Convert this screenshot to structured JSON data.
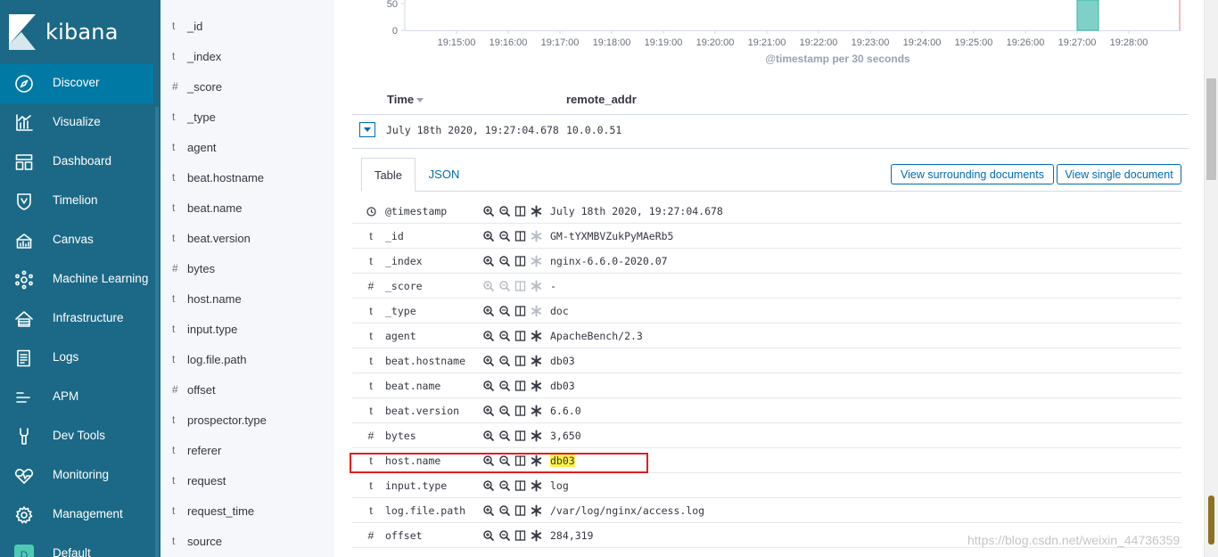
{
  "colors": {
    "nav_bg": "#1b6986",
    "nav_active": "#0079a5",
    "accent": "#006bb4",
    "bar": "#7fd1c8",
    "highlight": "#fff049",
    "annotation_box": "#e01e1e"
  },
  "nav": {
    "brand": "kibana",
    "items": [
      {
        "label": "Discover",
        "icon": "compass-icon",
        "active": true
      },
      {
        "label": "Visualize",
        "icon": "bar-chart-icon"
      },
      {
        "label": "Dashboard",
        "icon": "dashboard-icon"
      },
      {
        "label": "Timelion",
        "icon": "shield-icon"
      },
      {
        "label": "Canvas",
        "icon": "canvas-icon"
      },
      {
        "label": "Machine Learning",
        "icon": "ml-icon"
      },
      {
        "label": "Infrastructure",
        "icon": "infrastructure-icon"
      },
      {
        "label": "Logs",
        "icon": "logs-icon"
      },
      {
        "label": "APM",
        "icon": "apm-icon"
      },
      {
        "label": "Dev Tools",
        "icon": "wrench-icon"
      },
      {
        "label": "Monitoring",
        "icon": "heartbeat-icon"
      },
      {
        "label": "Management",
        "icon": "gear-icon"
      },
      {
        "label": "Default",
        "icon": "space-avatar-icon",
        "avatar_letter": "D"
      }
    ]
  },
  "field_list": [
    {
      "type": "t",
      "name": "_id"
    },
    {
      "type": "t",
      "name": "_index"
    },
    {
      "type": "#",
      "name": "_score"
    },
    {
      "type": "t",
      "name": "_type"
    },
    {
      "type": "t",
      "name": "agent"
    },
    {
      "type": "t",
      "name": "beat.hostname"
    },
    {
      "type": "t",
      "name": "beat.name"
    },
    {
      "type": "t",
      "name": "beat.version"
    },
    {
      "type": "#",
      "name": "bytes"
    },
    {
      "type": "t",
      "name": "host.name"
    },
    {
      "type": "t",
      "name": "input.type"
    },
    {
      "type": "t",
      "name": "log.file.path"
    },
    {
      "type": "#",
      "name": "offset"
    },
    {
      "type": "t",
      "name": "prospector.type"
    },
    {
      "type": "t",
      "name": "referer"
    },
    {
      "type": "t",
      "name": "request"
    },
    {
      "type": "t",
      "name": "request_time"
    },
    {
      "type": "t",
      "name": "source"
    }
  ],
  "chart_data": {
    "type": "bar",
    "xlabel": "@timestamp per 30 seconds",
    "ylabel": "",
    "y_ticks": [
      0,
      50
    ],
    "x_ticks": [
      "19:15:00",
      "19:16:00",
      "19:17:00",
      "19:18:00",
      "19:19:00",
      "19:20:00",
      "19:21:00",
      "19:22:00",
      "19:23:00",
      "19:24:00",
      "19:25:00",
      "19:26:00",
      "19:27:00",
      "19:28:00"
    ],
    "bars": [
      {
        "x": "19:27:00",
        "value": 100
      }
    ],
    "ylim_visible": [
      0,
      60
    ]
  },
  "table_header": {
    "time_col": "Time",
    "field_col": "remote_addr"
  },
  "doc_row": {
    "time": "July 18th 2020, 19:27:04.678",
    "remote_addr": "10.0.0.51"
  },
  "tabs": {
    "table": "Table",
    "json": "JSON"
  },
  "buttons": {
    "surrounding": "View surrounding documents",
    "single": "View single document"
  },
  "detail_rows": [
    {
      "type": "clock-icon",
      "field": "@timestamp",
      "value": "July 18th 2020, 19:27:04.678",
      "filters_enabled": true,
      "exists_enabled": true
    },
    {
      "type": "t",
      "field": "_id",
      "value": "GM-tYXMBVZukPyMAeRb5",
      "filters_enabled": true,
      "exists_enabled": false
    },
    {
      "type": "t",
      "field": "_index",
      "value": "nginx-6.6.0-2020.07",
      "filters_enabled": true,
      "exists_enabled": false
    },
    {
      "type": "#",
      "field": "_score",
      "value": " -",
      "filters_enabled": false,
      "exists_enabled": false
    },
    {
      "type": "t",
      "field": "_type",
      "value": "doc",
      "filters_enabled": true,
      "exists_enabled": false
    },
    {
      "type": "t",
      "field": "agent",
      "value": "ApacheBench/2.3",
      "filters_enabled": true,
      "exists_enabled": true
    },
    {
      "type": "t",
      "field": "beat.hostname",
      "value": "db03",
      "filters_enabled": true,
      "exists_enabled": true
    },
    {
      "type": "t",
      "field": "beat.name",
      "value": "db03",
      "filters_enabled": true,
      "exists_enabled": true
    },
    {
      "type": "t",
      "field": "beat.version",
      "value": "6.6.0",
      "filters_enabled": true,
      "exists_enabled": true
    },
    {
      "type": "#",
      "field": "bytes",
      "value": "3,650",
      "filters_enabled": true,
      "exists_enabled": true
    },
    {
      "type": "t",
      "field": "host.name",
      "value": "db03",
      "filters_enabled": true,
      "exists_enabled": true,
      "highlighted": true
    },
    {
      "type": "t",
      "field": "input.type",
      "value": "log",
      "filters_enabled": true,
      "exists_enabled": true
    },
    {
      "type": "t",
      "field": "log.file.path",
      "value": "/var/log/nginx/access.log",
      "filters_enabled": true,
      "exists_enabled": true
    },
    {
      "type": "#",
      "field": "offset",
      "value": "284,319",
      "filters_enabled": true,
      "exists_enabled": true
    }
  ],
  "watermark": "https://blog.csdn.net/weixin_44736359"
}
